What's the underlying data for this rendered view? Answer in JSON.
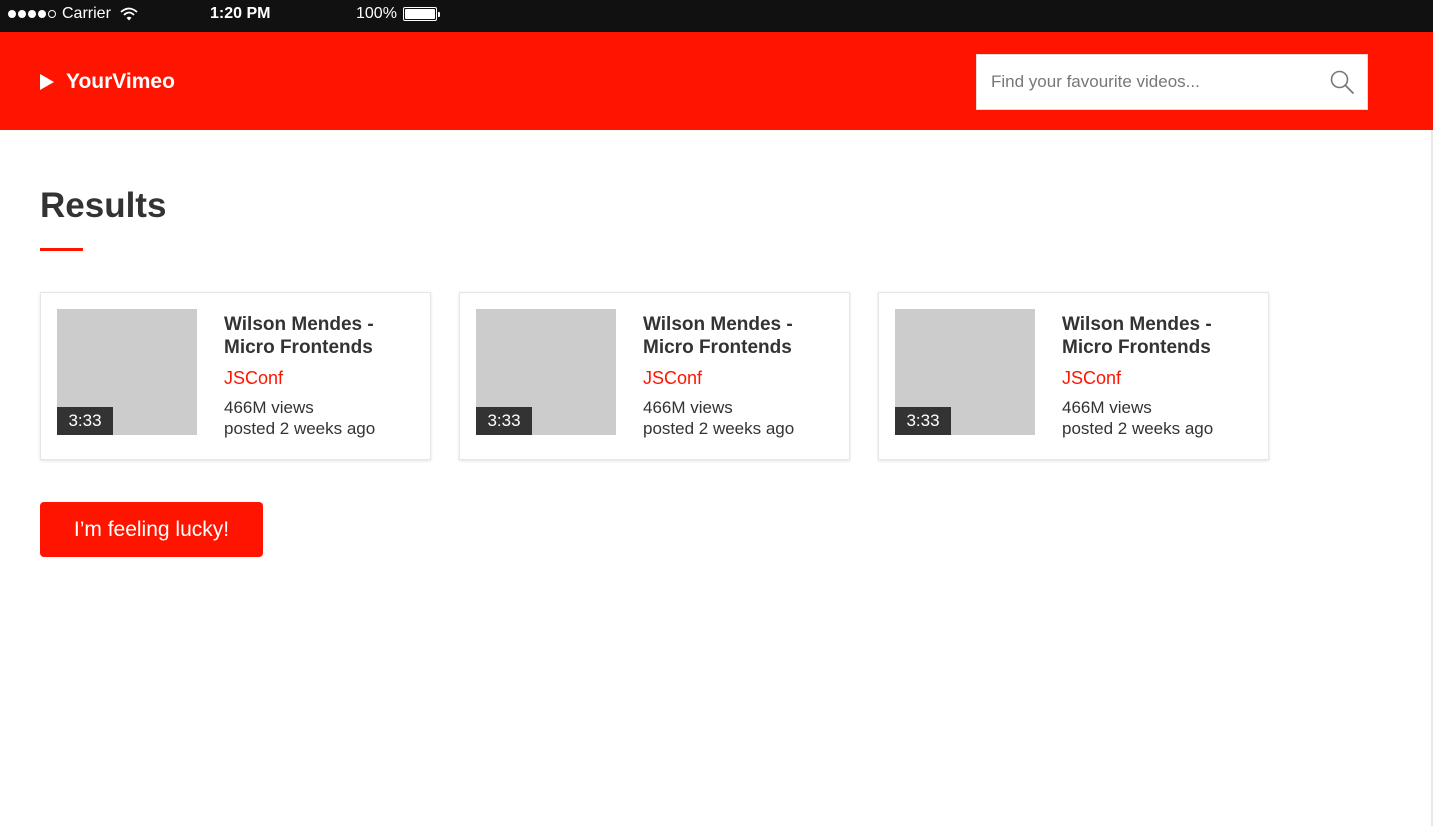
{
  "status_bar": {
    "carrier": "Carrier",
    "time": "1:20 PM",
    "battery": "100%"
  },
  "header": {
    "brand": "YourVimeo",
    "search": {
      "placeholder": "Find your favourite videos...",
      "value": ""
    }
  },
  "main": {
    "title": "Results",
    "videos": [
      {
        "title": "Wilson Mendes - Micro Frontends",
        "channel": "JSConf",
        "views": "466M views",
        "posted": "posted 2 weeks ago",
        "duration": "3:33"
      },
      {
        "title": "Wilson Mendes - Micro Frontends",
        "channel": "JSConf",
        "views": "466M views",
        "posted": "posted 2 weeks ago",
        "duration": "3:33"
      },
      {
        "title": "Wilson Mendes - Micro Frontends",
        "channel": "JSConf",
        "views": "466M views",
        "posted": "posted 2 weeks ago",
        "duration": "3:33"
      }
    ],
    "lucky_button": "I’m feeling lucky!"
  },
  "colors": {
    "accent": "#ff1400",
    "text": "#333333",
    "thumbnail": "#cccccc"
  },
  "icons": {
    "brand": "play-icon",
    "search": "search-icon",
    "wifi": "wifi-icon",
    "battery": "battery-icon"
  }
}
